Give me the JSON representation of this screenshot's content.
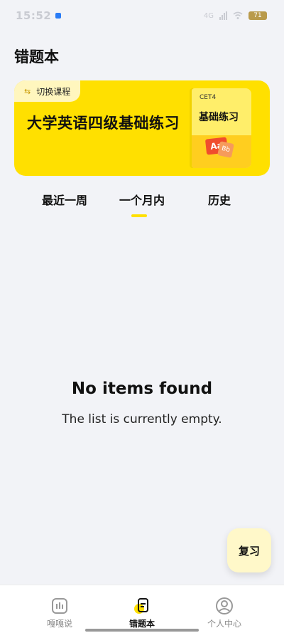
{
  "status_bar": {
    "time": "15:52",
    "network_label": "4G",
    "battery": "71"
  },
  "page": {
    "title": "错题本"
  },
  "banner": {
    "switch_label": "切换课程",
    "course_title": "大学英语四级基础练习",
    "book_tag": "CET4",
    "book_title": "基础练习",
    "book_badge": "Aa",
    "book_badge_small": "Bb"
  },
  "tabs": [
    {
      "label": "最近一周",
      "active": false
    },
    {
      "label": "一个月内",
      "active": true
    },
    {
      "label": "历史",
      "active": false
    }
  ],
  "empty_state": {
    "title": "No items found",
    "subtitle": "The list is currently empty."
  },
  "review_button": {
    "label": "复习"
  },
  "bottom_nav": {
    "items": [
      {
        "label": "嘎嘎说",
        "icon": "chat-bars-icon",
        "active": false
      },
      {
        "label": "错题本",
        "icon": "notebook-icon",
        "active": true
      },
      {
        "label": "个人中心",
        "icon": "user-icon",
        "active": false
      }
    ]
  },
  "colors": {
    "accent": "#FFE000",
    "background": "#F2F3F7"
  }
}
